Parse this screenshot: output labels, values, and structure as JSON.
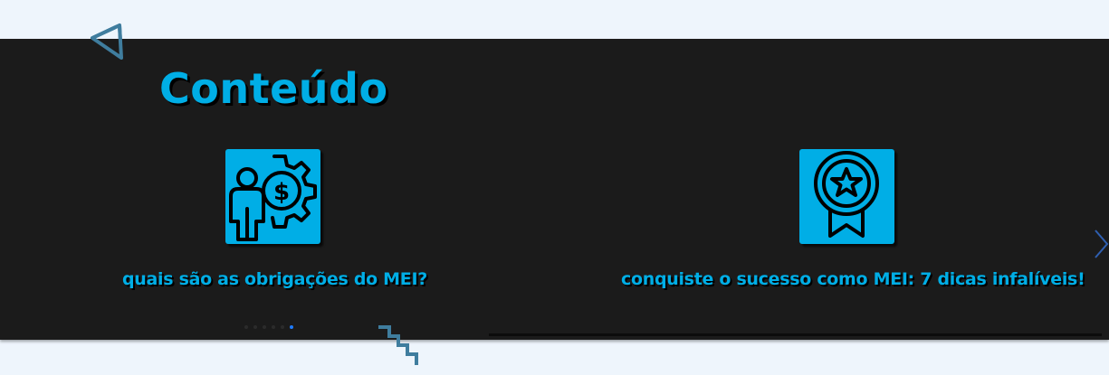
{
  "section": {
    "title": "Conteúdo"
  },
  "cards": [
    {
      "label": "quais são as obrigações do MEI?",
      "icon": "person-gear-dollar-icon"
    },
    {
      "label": "conquiste o sucesso como MEI: 7 dicas infalíveis!",
      "icon": "award-badge-icon"
    }
  ],
  "carousel": {
    "dot_count": 6,
    "active_dot": 5,
    "next_icon": "chevron-right-icon"
  },
  "colors": {
    "page_background": "#eef5fc",
    "band_background": "#1b1b1b",
    "accent": "#00aee6",
    "active_dot": "#1e7bff",
    "decoration": "#3f7d9e"
  }
}
